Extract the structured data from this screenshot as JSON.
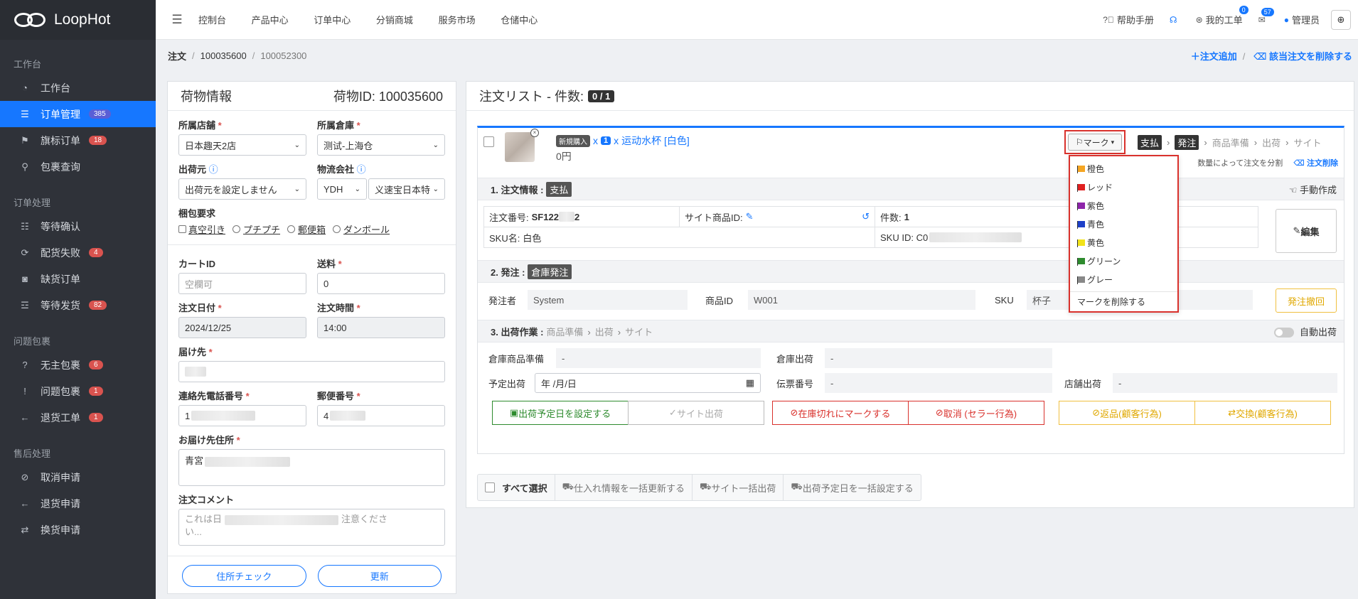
{
  "app": {
    "name": "LoopHot"
  },
  "topnav": [
    "控制台",
    "产品中心",
    "订单中心",
    "分销商城",
    "服务市场",
    "仓储中心"
  ],
  "topright": {
    "help": "帮助手册",
    "ticket": "我的工单",
    "ticket_count": "0",
    "mail_count": "57",
    "user": "管理员"
  },
  "sidebar": {
    "group1": "工作台",
    "group2": "订单处理",
    "group3": "问题包裹",
    "group4": "售后处理",
    "items": [
      {
        "label": "工作台"
      },
      {
        "label": "订单管理",
        "badge": "385"
      },
      {
        "label": "旗标订单",
        "badge": "18"
      },
      {
        "label": "包裹查询"
      },
      {
        "label": "等待确认"
      },
      {
        "label": "配货失败",
        "badge": "4"
      },
      {
        "label": "缺货订单"
      },
      {
        "label": "等待发货",
        "badge": "82"
      },
      {
        "label": "无主包裹",
        "badge": "6"
      },
      {
        "label": "问题包裹",
        "badge": "1"
      },
      {
        "label": "退货工单",
        "badge": "1"
      },
      {
        "label": "取消申请"
      },
      {
        "label": "退货申请"
      },
      {
        "label": "换货申请"
      }
    ]
  },
  "breadcrumb": {
    "c1": "注文",
    "c2": "100035600",
    "c3": "100052300",
    "add": "＋注文追加",
    "remove": "該当注文を削除する"
  },
  "left": {
    "title": "荷物情報",
    "package_id": "荷物ID: 100035600",
    "store_label": "所属店舗",
    "store_value": "日本趣天2店",
    "warehouse_label": "所属倉庫",
    "warehouse_value": "测试-上海仓",
    "shipper_label": "出荷元",
    "shipper_value": "出荷元を設定しません",
    "logistics_label": "物流会社",
    "logistics_value1": "YDH",
    "logistics_value2": "义速宝日本特",
    "packing_label": "梱包要求",
    "packing_opts": [
      "真空引き",
      "プチプチ",
      "郵便箱",
      "ダンボール"
    ],
    "cart_label": "カートID",
    "cart_placeholder": "空欄可",
    "fee_label": "送料",
    "fee_value": "0",
    "date_label": "注文日付",
    "date_value": "2024/12/25",
    "time_label": "注文時間",
    "time_value": "14:00",
    "dest_label": "届け先",
    "phone_label": "連絡先電話番号",
    "phone_value": "1",
    "zip_label": "郵便番号",
    "zip_value": "4",
    "addr_label": "お届け先住所",
    "addr_value": "青宮",
    "comment_label": "注文コメント",
    "comment_placeholder": "これは日",
    "comment_placeholder2": "注意くださ",
    "comment_placeholder3": "い...",
    "check_btn": "住所チェック",
    "update_btn": "更新"
  },
  "right": {
    "title": "注文リスト - 件数:",
    "count": "0 / 1",
    "tag_new": "新規購入",
    "x": "x",
    "qty": "1",
    "x2": "x",
    "product": "运动水杯 [白色]",
    "price": "0円",
    "mark": "マーク",
    "flow": [
      "支払",
      "発注",
      "商品準備",
      "出荷",
      "サイト"
    ],
    "split": "数量によって注文を分割",
    "delete": "注文削除",
    "s1_title": "1. 注文情報 :",
    "s1_tag": "支払",
    "manual": "手動作成",
    "order_no_label": "注文番号:",
    "order_no": "SF122",
    "order_no_suffix": "2",
    "site_item_label": "サイト商品ID:",
    "count_label": "件数:",
    "count_value": "1",
    "sku_name_label": "SKU名:",
    "sku_name": "白色",
    "sku_id_label": "SKU ID: C0",
    "edit_btn": "編集",
    "s2_title": "2. 発注 :",
    "s2_tag": "倉庫発注",
    "orderer_label": "発注者",
    "orderer": "System",
    "pid_label": "商品ID",
    "pid": "W001",
    "sku_label": "SKU",
    "sku": "杯子",
    "cancel_order": "発注撤回",
    "s3_title": "3. 出荷作業 :",
    "s3_flow": [
      "商品準備",
      "出荷",
      "サイト"
    ],
    "auto_ship": "自動出荷",
    "prep_label": "倉庫商品準備",
    "prep": "-",
    "wh_ship_label": "倉庫出荷",
    "wh_ship": "-",
    "plan_label": "予定出荷",
    "plan": "年 /月/日",
    "slip_label": "伝票番号",
    "slip": "-",
    "store_ship_label": "店舗出荷",
    "store_ship": "-",
    "actions": [
      "出荷予定日を設定する",
      "サイト出荷",
      "在庫切れにマークする",
      "取消 (セラー行為)",
      "返品(顧客行為)",
      "交換(顧客行為)"
    ],
    "bottom": [
      "すべて選択",
      "仕入れ情報を一括更新する",
      "サイト一括出荷",
      "出荷予定日を一括設定する"
    ]
  },
  "dropdown": {
    "items": [
      {
        "label": "橙色",
        "color": "#f5a623"
      },
      {
        "label": "レッド",
        "color": "#e02020"
      },
      {
        "label": "紫色",
        "color": "#8e24aa"
      },
      {
        "label": "青色",
        "color": "#1e40c8"
      },
      {
        "label": "黄色",
        "color": "#f2e31a"
      },
      {
        "label": "グリーン",
        "color": "#2e8b2e"
      },
      {
        "label": "グレー",
        "color": "#888888"
      }
    ],
    "remove": "マークを削除する"
  }
}
